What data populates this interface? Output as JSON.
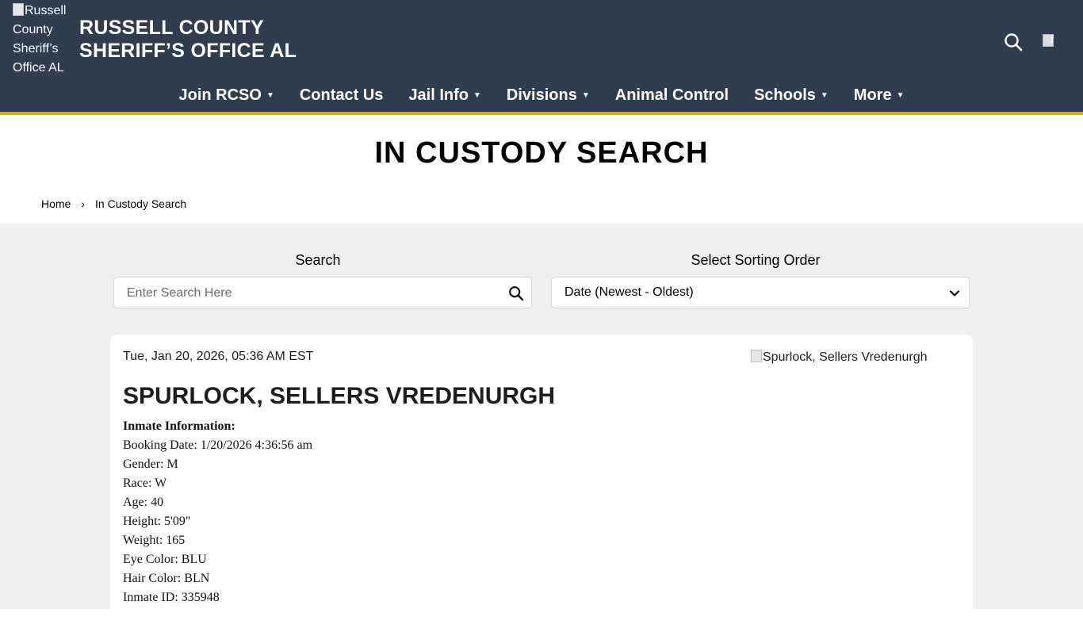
{
  "header": {
    "logo_alt": "Russell County Sheriff’s Office AL",
    "title_line1": "RUSSELL COUNTY",
    "title_line2": "SHERIFF’S OFFICE AL",
    "translate_alt": "f"
  },
  "nav": {
    "items": [
      {
        "label": "Join RCSO",
        "dropdown": true
      },
      {
        "label": "Contact Us",
        "dropdown": false
      },
      {
        "label": "Jail Info",
        "dropdown": true
      },
      {
        "label": "Divisions",
        "dropdown": true
      },
      {
        "label": "Animal Control",
        "dropdown": false
      },
      {
        "label": "Schools",
        "dropdown": true
      },
      {
        "label": "More",
        "dropdown": true
      }
    ],
    "caret": "▼"
  },
  "page": {
    "title": "IN CUSTODY SEARCH",
    "breadcrumb": {
      "home": "Home",
      "separator": "›",
      "current": "In Custody Search"
    }
  },
  "search": {
    "label": "Search",
    "placeholder": "Enter Search Here",
    "value": ""
  },
  "sort": {
    "label": "Select Sorting Order",
    "selected": "Date (Newest - Oldest)"
  },
  "record": {
    "date": "Tue, Jan 20, 2026, 05:36 AM EST",
    "photo_alt": "Spurlock, Sellers Vredenurgh",
    "name": "SPURLOCK, SELLERS VREDENURGH",
    "info_heading": "Inmate Information:",
    "fields": [
      "Booking Date: 1/20/2026 4:36:56 am",
      "Gender: M",
      "Race: W",
      "Age: 40",
      "Height: 5'09\"",
      "Weight: 165",
      "Eye Color: BLU",
      "Hair Color: BLN",
      "Inmate ID: 335948"
    ]
  },
  "colors": {
    "header_bg": "#2f3d4f",
    "accent": "#d4a81e",
    "content_bg": "#efefef"
  }
}
